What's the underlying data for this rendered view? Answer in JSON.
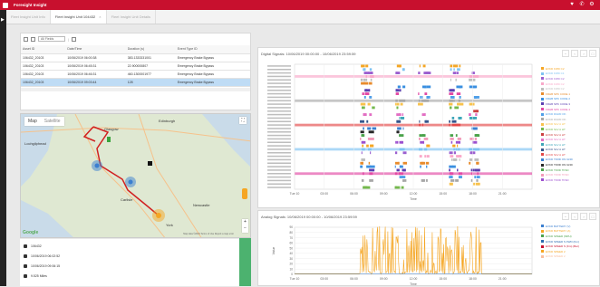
{
  "header": {
    "title": "Foresight Insight"
  },
  "tabs": [
    {
      "label": "Fleet Insight Unit Info",
      "active": false
    },
    {
      "label": "Fleet Insight Unit 104432",
      "active": true
    },
    {
      "label": "Fleet Insight Unit Details",
      "active": false
    }
  ],
  "grid": {
    "fields_placeholder": "All Fields",
    "columns": [
      "Asset ID",
      "Date/Time",
      "Duration (s)",
      "Event Type ID"
    ],
    "rows": [
      [
        "106432_20103",
        "10/06/2019 06:00:38",
        "383.1333331001",
        "Emergency Brake Bypass"
      ],
      [
        "106432_20103",
        "10/06/2019 06:45:31",
        "22.900000807",
        "Emergency Brake Bypass"
      ],
      [
        "106432_20103",
        "10/06/2019 06:46:31",
        "460.1300001977",
        "Emergency Brake Bypass"
      ],
      [
        "106432_20103",
        "10/06/2019 09:03:44",
        "128",
        "Emergency Brake Bypass"
      ]
    ],
    "selected_row": 3
  },
  "map": {
    "tab_map": "Map",
    "tab_satellite": "Satellite",
    "cities": [
      "Edinburgh",
      "Glasgow",
      "Lochgilphead",
      "Carlisle",
      "Newcastle",
      "York"
    ],
    "google": "Google",
    "credit": "Map data ©2019  Terms of Use  Report a map error"
  },
  "info": {
    "unit": "106432",
    "start": "10/06/2019 06:02:52",
    "end": "10/06/2019 09:06:15",
    "distance": "9.525 Miles"
  },
  "digital": {
    "title": "Digital Signals: 10/06/2019 00:00:00 - 10/06/2019 23:59:59",
    "xlabel": "Time",
    "ticks": [
      "Tue 10",
      "03:00",
      "06:00",
      "09:00",
      "12:00",
      "15:00",
      "18:00",
      "21:00"
    ],
    "legend": [
      {
        "name": "EVKD FWD C2",
        "color": "#f5a623"
      },
      {
        "name": "EVKD FWD C1",
        "color": "#7ec3f2"
      },
      {
        "name": "EVKD FWD C2",
        "color": "#9b5fcf"
      },
      {
        "name": "EVKD FWD C2",
        "color": "#f9a8c9"
      },
      {
        "name": "EVKD FWD C2",
        "color": "#bdbdbd"
      },
      {
        "name": "FRHB SPK CODE 1",
        "color": "#e88b2c"
      },
      {
        "name": "FRHB SPK CODE 2",
        "color": "#3a8fe0"
      },
      {
        "name": "FRHB SPK CODE 3",
        "color": "#5b3fb0"
      },
      {
        "name": "FRHB SPK CODE 4",
        "color": "#e24aa5"
      },
      {
        "name": "EVKD DGR0 OK",
        "color": "#4f9fe8"
      },
      {
        "name": "EVKD DGR0 OK",
        "color": "#a8a8a8"
      },
      {
        "name": "EVKD SLV A HT",
        "color": "#f8c24c"
      },
      {
        "name": "EVKD SLV A HT",
        "color": "#74b84c"
      },
      {
        "name": "EVKD SLV A HT",
        "color": "#cc4040"
      },
      {
        "name": "EVKD SLV A HT",
        "color": "#e26fc3"
      },
      {
        "name": "EVKD SLV A HT",
        "color": "#3da6b8"
      },
      {
        "name": "EVKD SLV A HT",
        "color": "#35558c"
      },
      {
        "name": "EVKD SLV A HT",
        "color": "#e44949"
      },
      {
        "name": "EVKD TFRD ON GND",
        "color": "#3b7fd0"
      },
      {
        "name": "EVKD TFRD ON GND",
        "color": "#282828"
      },
      {
        "name": "EVKD TFRD TFSD",
        "color": "#4ca34c"
      },
      {
        "name": "EVKD TFRD TFSD",
        "color": "#f29bb9"
      },
      {
        "name": "EVKD TFRD TFSD",
        "color": "#9c4fcf"
      }
    ]
  },
  "analog": {
    "title": "Analog Signals: 10/06/2019 00:00:00 - 10/06/2019 23:59:59",
    "xlabel": "Time",
    "ylabel": "Value",
    "yticks": [
      "0",
      "10",
      "20",
      "30",
      "40",
      "50",
      "60",
      "70",
      "80",
      "90"
    ],
    "ticks": [
      "Tue 10",
      "03:00",
      "06:00",
      "09:00",
      "12:00",
      "15:00",
      "18:00",
      "21:00"
    ],
    "legend": [
      {
        "name": "EVKD BATTERY (V)",
        "color": "#3b7fd0"
      },
      {
        "name": "EVKD BATTERY (A)",
        "color": "#f5a623"
      },
      {
        "name": "EVKD SPEED (MPH)",
        "color": "#4ca34c"
      },
      {
        "name": "EVKD SPEED S FWD (Km)",
        "color": "#2b6cb0"
      },
      {
        "name": "EVKD SPEED S (Km) (Bar)",
        "color": "#c8102e"
      },
      {
        "name": "EVKD SPEED 2",
        "color": "#f5a623"
      },
      {
        "name": "EVKD SPEED 2",
        "color": "#f9c0a0"
      }
    ]
  }
}
